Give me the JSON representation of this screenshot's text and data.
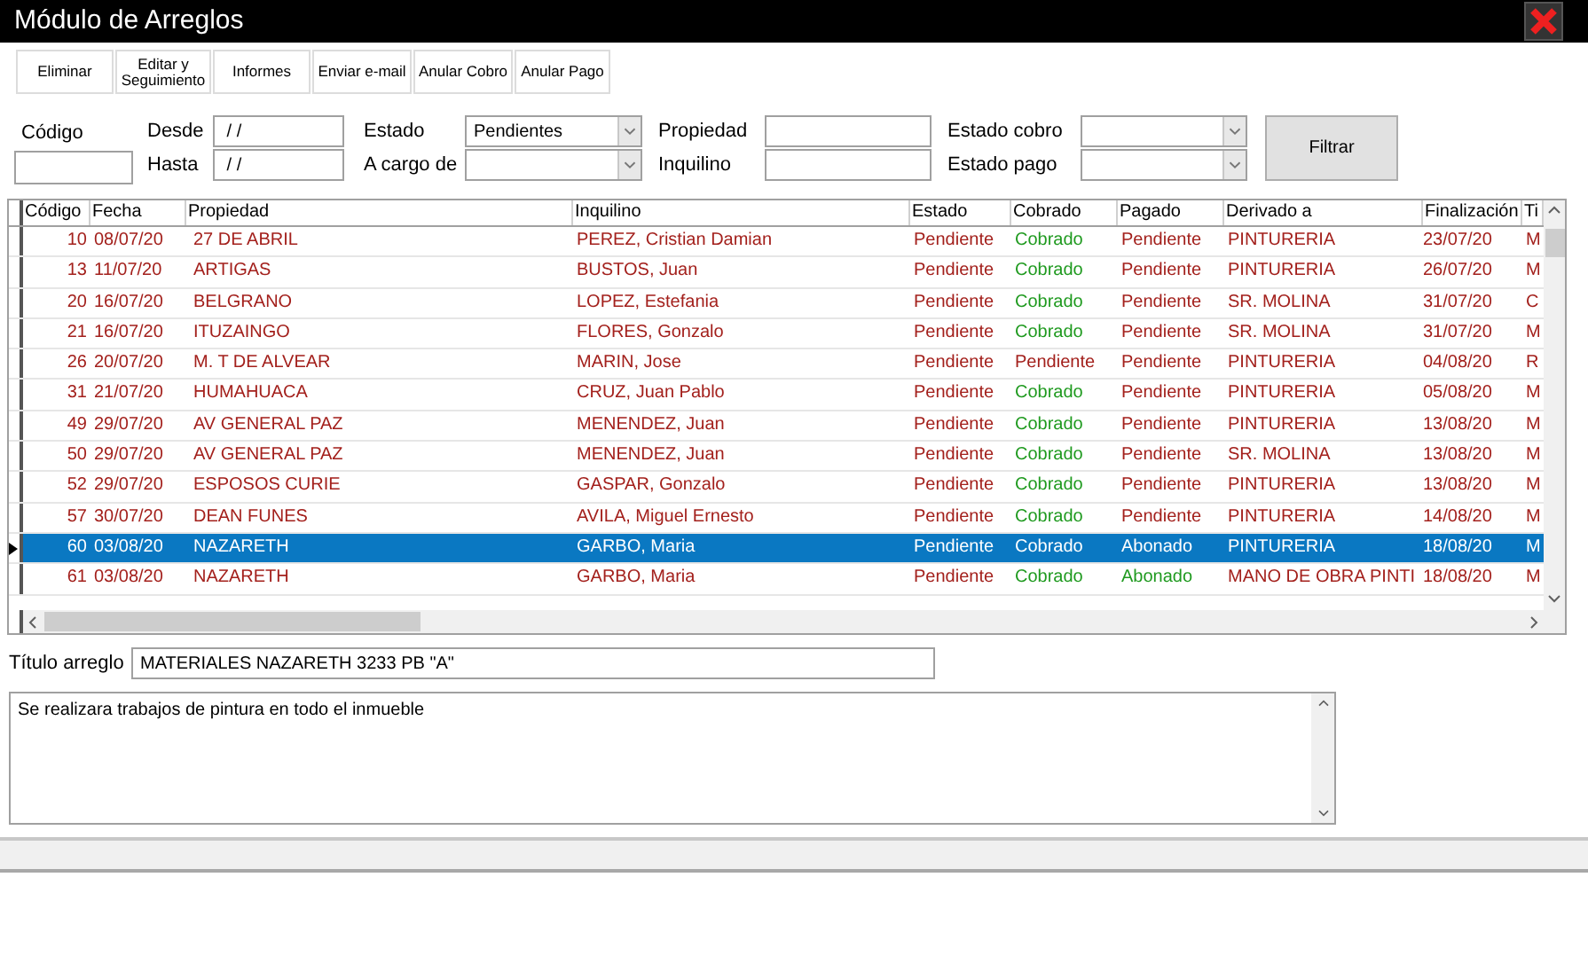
{
  "window": {
    "title": "Módulo de Arreglos"
  },
  "toolbar": {
    "buttons": [
      {
        "label": "Eliminar"
      },
      {
        "label": "Editar y Seguimiento"
      },
      {
        "label": "Informes"
      },
      {
        "label": "Enviar e-mail"
      },
      {
        "label": "Anular Cobro"
      },
      {
        "label": "Anular Pago"
      }
    ]
  },
  "filters": {
    "codigo": {
      "label": "Código"
    },
    "desde": {
      "label": "Desde",
      "value": " / /"
    },
    "hasta": {
      "label": "Hasta",
      "value": " / /"
    },
    "estado": {
      "label": "Estado",
      "value": "Pendientes"
    },
    "a_cargo_de": {
      "label": "A cargo de"
    },
    "propiedad": {
      "label": "Propiedad"
    },
    "inquilino": {
      "label": "Inquilino"
    },
    "estado_cobro": {
      "label": "Estado cobro"
    },
    "estado_pago": {
      "label": "Estado pago"
    },
    "button": "Filtrar"
  },
  "table": {
    "columns": [
      "Código",
      "Fecha",
      "Propiedad",
      "Inquilino",
      "Estado",
      "Cobrado",
      "Pagado",
      "Derivado a",
      "Finalización",
      "Ti"
    ],
    "rows": [
      {
        "selected": false,
        "codigo": "10",
        "fecha": "08/07/20",
        "propiedad": "27 DE ABRIL",
        "inquilino": "PEREZ, Cristian Damian",
        "estado": "Pendiente",
        "cobrado": {
          "text": "Cobrado",
          "done": true
        },
        "pagado": {
          "text": "Pendiente",
          "done": false
        },
        "derivado": "PINTURERIA",
        "finalizacion": "23/07/20",
        "column_10": "M"
      },
      {
        "selected": false,
        "codigo": "13",
        "fecha": "11/07/20",
        "propiedad": "ARTIGAS",
        "inquilino": "BUSTOS, Juan",
        "estado": "Pendiente",
        "cobrado": {
          "text": "Cobrado",
          "done": true
        },
        "pagado": {
          "text": "Pendiente",
          "done": false
        },
        "derivado": "PINTURERIA",
        "finalizacion": "26/07/20",
        "column_10": "M"
      },
      {
        "selected": false,
        "codigo": "20",
        "fecha": "16/07/20",
        "propiedad": "BELGRANO",
        "inquilino": "LOPEZ, Estefania",
        "estado": "Pendiente",
        "cobrado": {
          "text": "Cobrado",
          "done": true
        },
        "pagado": {
          "text": "Pendiente",
          "done": false
        },
        "derivado": "SR. MOLINA",
        "finalizacion": "31/07/20",
        "column_10": "C"
      },
      {
        "selected": false,
        "codigo": "21",
        "fecha": "16/07/20",
        "propiedad": "ITUZAINGO",
        "inquilino": "FLORES, Gonzalo",
        "estado": "Pendiente",
        "cobrado": {
          "text": "Cobrado",
          "done": true
        },
        "pagado": {
          "text": "Pendiente",
          "done": false
        },
        "derivado": "SR. MOLINA",
        "finalizacion": "31/07/20",
        "column_10": "M"
      },
      {
        "selected": false,
        "codigo": "26",
        "fecha": "20/07/20",
        "propiedad": "M. T DE ALVEAR",
        "inquilino": "MARIN, Jose",
        "estado": "Pendiente",
        "cobrado": {
          "text": "Pendiente",
          "done": false
        },
        "pagado": {
          "text": "Pendiente",
          "done": false
        },
        "derivado": "PINTURERIA",
        "finalizacion": "04/08/20",
        "column_10": "R"
      },
      {
        "selected": false,
        "codigo": "31",
        "fecha": "21/07/20",
        "propiedad": "HUMAHUACA",
        "inquilino": "CRUZ, Juan Pablo",
        "estado": "Pendiente",
        "cobrado": {
          "text": "Cobrado",
          "done": true
        },
        "pagado": {
          "text": "Pendiente",
          "done": false
        },
        "derivado": "PINTURERIA",
        "finalizacion": "05/08/20",
        "column_10": "M"
      },
      {
        "selected": false,
        "codigo": "49",
        "fecha": "29/07/20",
        "propiedad": "AV GENERAL PAZ",
        "inquilino": "MENENDEZ, Juan",
        "estado": "Pendiente",
        "cobrado": {
          "text": "Cobrado",
          "done": true
        },
        "pagado": {
          "text": "Pendiente",
          "done": false
        },
        "derivado": "PINTURERIA",
        "finalizacion": "13/08/20",
        "column_10": "M"
      },
      {
        "selected": false,
        "codigo": "50",
        "fecha": "29/07/20",
        "propiedad": "AV GENERAL PAZ",
        "inquilino": "MENENDEZ, Juan",
        "estado": "Pendiente",
        "cobrado": {
          "text": "Cobrado",
          "done": true
        },
        "pagado": {
          "text": "Pendiente",
          "done": false
        },
        "derivado": "SR. MOLINA",
        "finalizacion": "13/08/20",
        "column_10": "M"
      },
      {
        "selected": false,
        "codigo": "52",
        "fecha": "29/07/20",
        "propiedad": "ESPOSOS CURIE",
        "inquilino": "GASPAR, Gonzalo",
        "estado": "Pendiente",
        "cobrado": {
          "text": "Cobrado",
          "done": true
        },
        "pagado": {
          "text": "Pendiente",
          "done": false
        },
        "derivado": "PINTURERIA",
        "finalizacion": "13/08/20",
        "column_10": "M"
      },
      {
        "selected": false,
        "codigo": "57",
        "fecha": "30/07/20",
        "propiedad": "DEAN FUNES",
        "inquilino": "AVILA, Miguel Ernesto",
        "estado": "Pendiente",
        "cobrado": {
          "text": "Cobrado",
          "done": true
        },
        "pagado": {
          "text": "Pendiente",
          "done": false
        },
        "derivado": "PINTURERIA",
        "finalizacion": "14/08/20",
        "column_10": "M"
      },
      {
        "selected": true,
        "codigo": "60",
        "fecha": "03/08/20",
        "propiedad": "NAZARETH",
        "inquilino": "GARBO, Maria",
        "estado": "Pendiente",
        "cobrado": {
          "text": "Cobrado"
        },
        "pagado": {
          "text": "Abonado"
        },
        "derivado": "PINTURERIA",
        "finalizacion": "18/08/20",
        "column_10": "M"
      },
      {
        "selected": false,
        "codigo": "61",
        "fecha": "03/08/20",
        "propiedad": "NAZARETH",
        "inquilino": "GARBO, Maria",
        "estado": "Pendiente",
        "cobrado": {
          "text": "Cobrado",
          "done": true
        },
        "pagado": {
          "text": "Abonado",
          "done": true
        },
        "derivado": "MANO DE OBRA PINTI",
        "finalizacion": "18/08/20",
        "column_10": "M"
      }
    ]
  },
  "titulo": {
    "label": "Título arreglo",
    "value": "MATERIALES NAZARETH 3233 PB \"A\""
  },
  "descripcion": {
    "value": "Se realizara trabajos de pintura en todo el inmueble"
  }
}
